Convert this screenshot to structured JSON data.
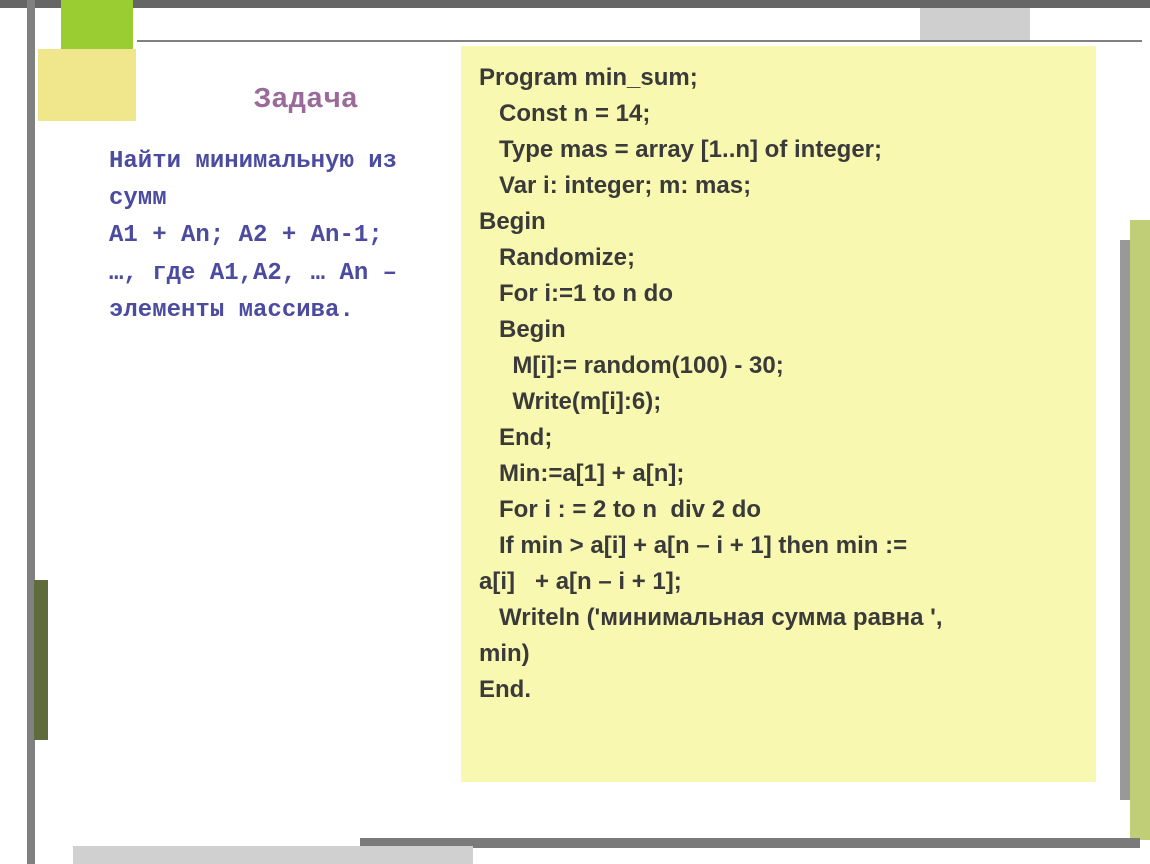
{
  "title": "Задача",
  "problem": {
    "line1": "Найти минимальную из сумм",
    "line2": "A1 + An; A2 + An-1;",
    "line3": "…, где A1,A2, … An –",
    "line4": "элементы массива."
  },
  "code": {
    "l1": "Program min_sum;",
    "l2": "   Const n = 14;",
    "l3": "   Type mas = array [1..n] of integer;",
    "l4": "   Var i: integer; m: mas;",
    "l5": "Begin",
    "l6": "   Randomize;",
    "l7": "   For i:=1 to n do",
    "l8": "   Begin",
    "l9": "     M[i]:= random(100) - 30;",
    "l10": "     Write(m[i]:6);",
    "l11": "   End;",
    "l12": "   Min:=a[1] + a[n];",
    "l13": "   For i : = 2 to n  div 2 do",
    "l14": "   If min > a[i] + a[n – i + 1] then min :=",
    "l15": "a[i]   + a[n – i + 1];",
    "l16": "   Writeln ('минимальная сумма равна ',",
    "l17": "min)",
    "l18": "End."
  }
}
